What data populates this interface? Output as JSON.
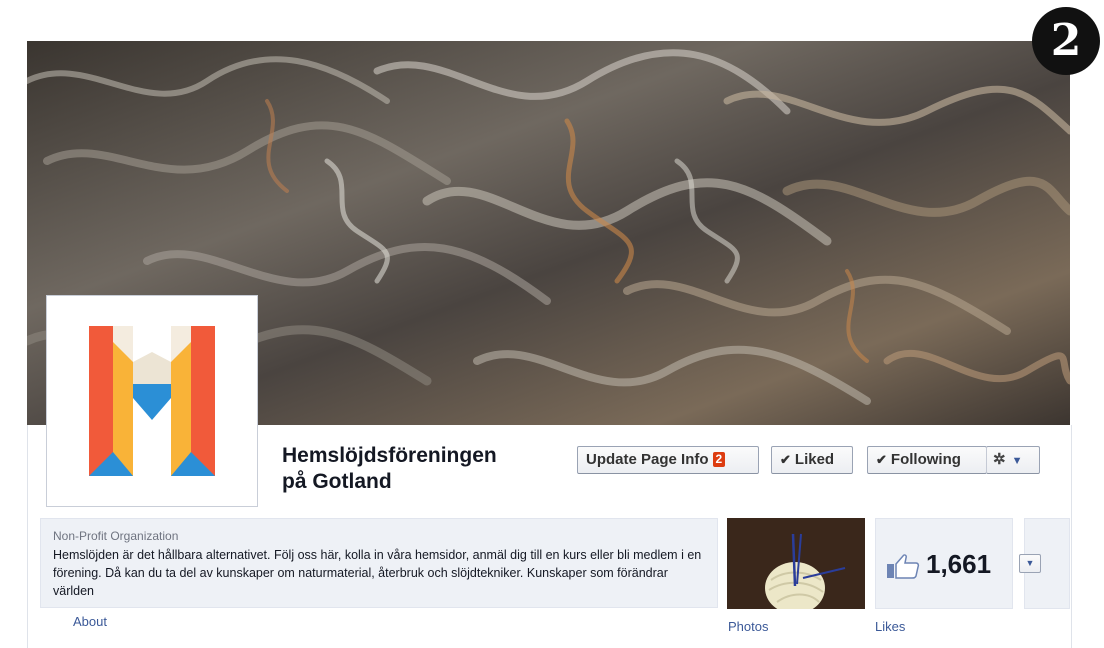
{
  "step_badge": "2",
  "page": {
    "name_line1": "Hemslöjdsföreningen",
    "name_line2": "på Gotland"
  },
  "actions": {
    "update_label": "Update Page Info",
    "update_count": "2",
    "liked_label": "Liked",
    "following_label": "Following"
  },
  "about": {
    "category": "Non-Profit Organization",
    "description": "Hemslöjden är det hållbara alternativet. Följ oss här, kolla in våra hemsidor, anmäl dig till en kurs eller bli medlem i en förening. Då kan du ta del av kunskaper om naturmaterial, återbruk och slöjdtekniker. Kunskaper som förändrar världen",
    "link": "About"
  },
  "photos": {
    "label": "Photos"
  },
  "likes": {
    "count": "1,661",
    "label": "Likes"
  },
  "icons": {
    "gear": "gear-icon",
    "check": "check-icon",
    "caret": "chevron-down-icon",
    "thumb": "thumbs-up-icon"
  },
  "colors": {
    "link": "#3b5998",
    "badge_red": "#dd3c10",
    "logo_orange": "#f15a3a",
    "logo_yellow": "#f9b338",
    "logo_blue": "#2b8fd6"
  }
}
